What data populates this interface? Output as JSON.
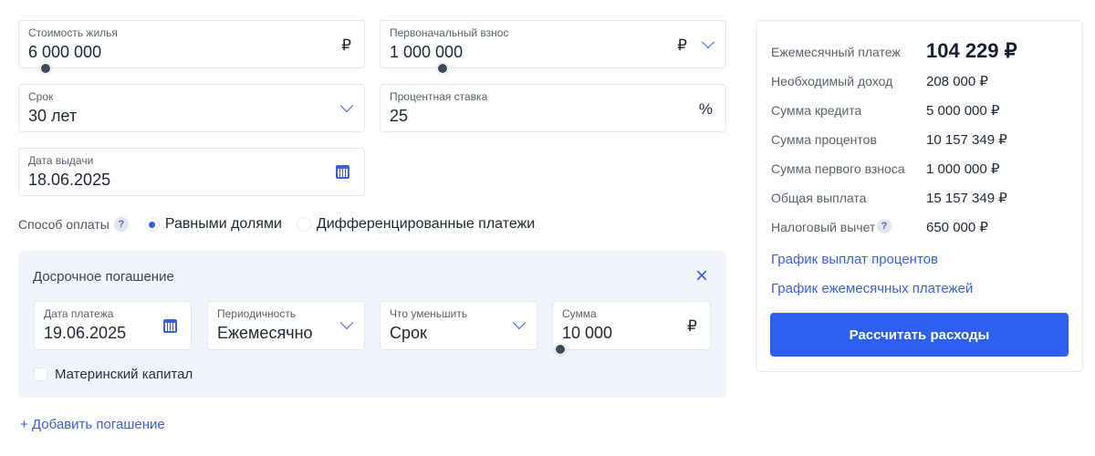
{
  "form": {
    "price": {
      "label": "Стоимость жилья",
      "value": "6 000 000",
      "suffix": "₽"
    },
    "down_payment": {
      "label": "Первоначальный взнос",
      "value": "1 000 000",
      "suffix": "₽"
    },
    "term": {
      "label": "Срок",
      "value": "30 лет"
    },
    "rate": {
      "label": "Процентная ставка",
      "value": "25",
      "suffix": "%"
    },
    "issue_date": {
      "label": "Дата выдачи",
      "value": "18.06.2025"
    },
    "payment_method": {
      "label": "Способ оплаты",
      "help": "?",
      "options": [
        "Равными долями",
        "Дифференцированные платежи"
      ],
      "selected": 0
    }
  },
  "early": {
    "title": "Досрочное погашение",
    "close": "×",
    "date": {
      "label": "Дата платежа",
      "value": "19.06.2025"
    },
    "period": {
      "label": "Периодичность",
      "value": "Ежемесячно"
    },
    "reduce": {
      "label": "Что уменьшить",
      "value": "Срок"
    },
    "amount": {
      "label": "Сумма",
      "value": "10 000",
      "suffix": "₽"
    },
    "maternity": {
      "label": "Материнский капитал",
      "checked": false
    },
    "add": "+ Добавить погашение"
  },
  "summary": {
    "rows": [
      {
        "label": "Ежемесячный платеж",
        "value": "104 229 ₽"
      },
      {
        "label": "Необходимый доход",
        "value": "208 000 ₽"
      },
      {
        "label": "Сумма кредита",
        "value": "5 000 000 ₽"
      },
      {
        "label": "Сумма процентов",
        "value": "10 157 349 ₽"
      },
      {
        "label": "Сумма первого взноса",
        "value": "1 000 000 ₽"
      },
      {
        "label": "Общая выплата",
        "value": "15 157 349 ₽"
      },
      {
        "label": "Налоговый вычет",
        "value": "650 000 ₽",
        "help": "?"
      }
    ],
    "links": [
      "График выплат процентов",
      "График ежемесячных платежей"
    ],
    "button": "Рассчитать расходы"
  },
  "colors": {
    "accent": "#2f5ff0",
    "panel": "#f1f4fb"
  }
}
